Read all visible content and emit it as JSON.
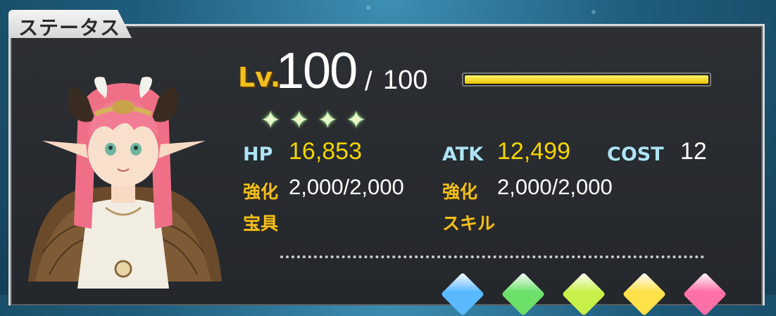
{
  "panel": {
    "title": "ステータス"
  },
  "level": {
    "label": "Lv.",
    "current": "100",
    "slash": "/",
    "max": "100",
    "progress": 1.0
  },
  "rarity": {
    "stars": 4,
    "star_glyph": "✦"
  },
  "stats": {
    "hp_label": "HP",
    "hp_value": "16,853",
    "atk_label": "ATK",
    "atk_value": "12,499",
    "cost_label": "COST",
    "cost_value": "12"
  },
  "enhance": {
    "hp_label": "強化",
    "hp_value": "2,000/2,000",
    "atk_label": "強化",
    "atk_value": "2,000/2,000"
  },
  "extras": {
    "np_label": "宝具",
    "skill_label": "スキル"
  },
  "gems": {
    "colors": [
      "#5ab8ff",
      "#6de06a",
      "#c8f04a",
      "#ffe14a",
      "#ff6fa8"
    ]
  },
  "colors": {
    "accent_gold": "#f0c020",
    "stat_blue": "#aee3f2",
    "xp_bar": "#e8c400"
  }
}
